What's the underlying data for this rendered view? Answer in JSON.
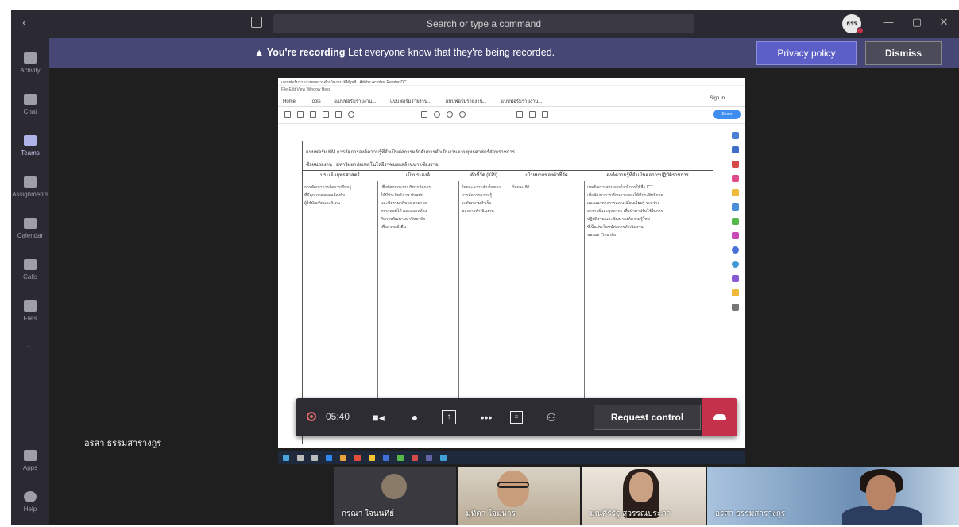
{
  "titlebar": {
    "search_placeholder": "Search or type a command",
    "avatar_initials": "ธรร",
    "min": "—",
    "max": "▢",
    "close": "✕",
    "back": "‹"
  },
  "rail": {
    "items": [
      {
        "label": "Activity",
        "active": false
      },
      {
        "label": "Chat",
        "active": false
      },
      {
        "label": "Teams",
        "active": true
      },
      {
        "label": "Assignments",
        "active": false
      },
      {
        "label": "Calendar",
        "active": false
      },
      {
        "label": "Calls",
        "active": false
      },
      {
        "label": "Files",
        "active": false
      },
      {
        "label": "...",
        "active": false
      },
      {
        "label": "Apps",
        "active": false
      },
      {
        "label": "Help",
        "active": false
      }
    ]
  },
  "banner": {
    "warning_icon": "▲",
    "bold_text": "You're recording",
    "text": "Let everyone know that they're being recorded.",
    "privacy_label": "Privacy policy",
    "dismiss_label": "Dismiss"
  },
  "shared_screen": {
    "window_title": "แบบฟอร์มรายงานผลการดำเนินงาน KM.pdf - Adobe Acrobat Reader DC",
    "menu": "File  Edit  View  Window  Help",
    "tabs": [
      "Home",
      "Tools",
      "แบบฟอร์มรายงาน...",
      "แบบฟอร์มรายงาน...",
      "แบบฟอร์มรายงาน...",
      "แบบฟอร์มรายงาน..."
    ],
    "sign_in": "Sign In",
    "share_label": "Share",
    "doc_title": "แบบฟอร์ม KM การจัดการองค์ความรู้ที่จำเป็นต่อการผลักดันการดำเนินงานตามยุทธศาสตร์ส่วนราชการ",
    "doc_subtitle": "ชื่อหน่วยงาน : มหาวิทยาลัยเทคโนโลยีราชมงคลล้านนา เชียงราย",
    "table_headers": [
      "ประเด็นยุทธศาสตร์",
      "เป้าประสงค์",
      "ตัวชี้วัด (KPI)",
      "เป้าหมายของตัวชี้วัด",
      "องค์ความรู้ที่จำเป็นต่อการปฏิบัติราชการ"
    ],
    "col1": "การพัฒนาการจัดการเรียนรู้\nที่มีคุณภาพสอดคล้องกับ\nผู้ใช้บัณฑิตและสังคม",
    "col2": "เพื่อพัฒนาระบบบริหารจัดการ\nให้มีประสิทธิภาพ ทันสมัย\nและมีธรรมาภิบาล สามารถ\nตรวจสอบได้ และสอดคล้อง\nกับการพัฒนามหาวิทยาลัย\nเพื่อความยั่งยืน",
    "col3": "ร้อยละความสำเร็จของ\nการจัดการความรู้\nระดับความสำเร็จ\nของการดำเนินงาน",
    "col4": "ร้อยละ 80",
    "col5": "เทคนิคการสอนออนไลน์ การใช้สื่อ ICT\nเพื่อพัฒนาการเรียนการสอนให้มีประสิทธิภาพ\nและแนวทางการแลกเปลี่ยนเรียนรู้ ระหว่าง\nอาจารย์และบุคลากร เพื่อนำมาปรับใช้ในการ\nปฏิบัติงาน และพัฒนาองค์ความรู้ใหม่\nที่เป็นประโยชน์ต่อการดำเนินงาน\nของมหาวิทยาลัย"
  },
  "controls": {
    "timer": "05:40",
    "request_control_label": "Request control"
  },
  "presenter_name": "อรสา ธรรมสารางกูร",
  "participants": [
    {
      "name": "กรุณา ใจนนทีย์"
    },
    {
      "name": "มุทิตา ใจมหาร"
    },
    {
      "name": "มณศิริรัฐ สุวรรณประภา"
    },
    {
      "name": "อรสา ธรรมสารางกูร"
    }
  ],
  "colors": {
    "banner_bg": "#464775",
    "privacy_btn": "#5b5fc7",
    "hangup": "#c4314b",
    "app_bg": "#201f1f"
  }
}
